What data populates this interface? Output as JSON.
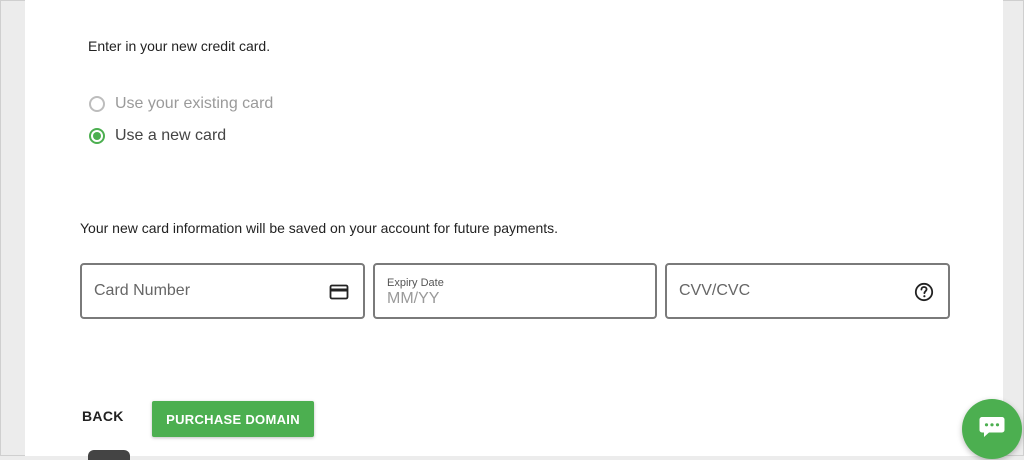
{
  "intro_text": "Enter in your new credit card.",
  "payment_options": [
    {
      "label": "Use your existing card",
      "selected": false
    },
    {
      "label": "Use a new card",
      "selected": true
    }
  ],
  "save_notice": "Your new card information will be saved on your account for future payments.",
  "card_number": {
    "placeholder": "Card Number",
    "icon": "credit-card-icon"
  },
  "expiry": {
    "label": "Expiry Date",
    "placeholder": "MM/YY"
  },
  "cvv": {
    "placeholder": "CVV/CVC",
    "icon": "help-circle-icon"
  },
  "actions": {
    "back_label": "BACK",
    "purchase_label": "PURCHASE DOMAIN"
  },
  "chat": {
    "icon": "chat-bubble-icon"
  },
  "colors": {
    "accent": "#4caf50",
    "field_border": "#7a7a7a"
  }
}
